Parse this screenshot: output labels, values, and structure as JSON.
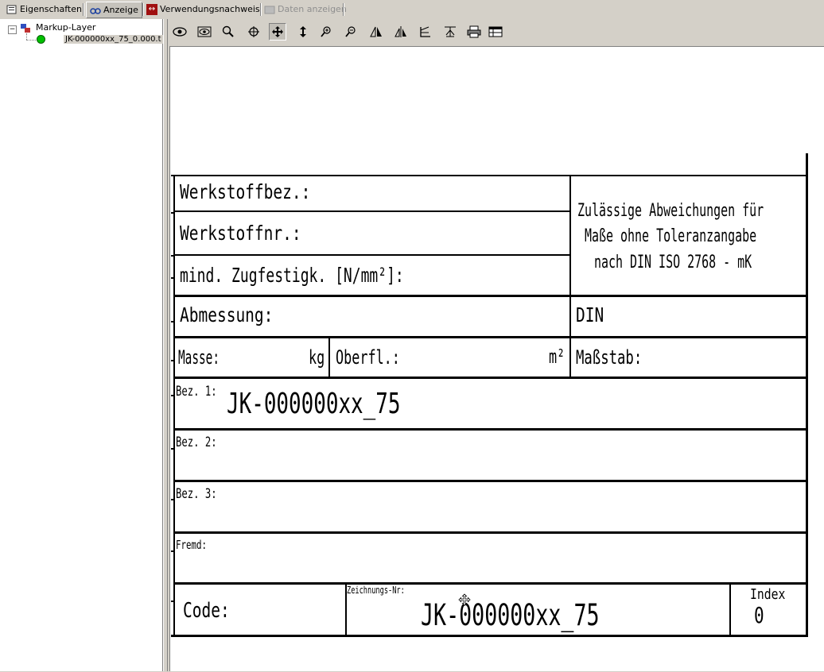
{
  "tabs": [
    {
      "label": "Eigenschaften",
      "icon": "properties-icon"
    },
    {
      "label": "Anzeige",
      "icon": "glasses-icon"
    },
    {
      "label": "Verwendungsnachweis",
      "icon": "where-used-icon"
    },
    {
      "label": "Daten anzeigen",
      "icon": "data-icon"
    }
  ],
  "tree": {
    "root_label": "Markup-Layer",
    "child_label": "JK-000000xx_75_0.000.t"
  },
  "toolbar": {
    "tools": [
      "eye-icon",
      "view-icon",
      "zoom-icon",
      "pan-center-icon",
      "move-icon",
      "vertical-arrow-icon",
      "zoom-in-icon",
      "zoom-out-icon",
      "mirror-horizontal-icon",
      "mirror-vertical-icon",
      "rotate-icon",
      "fit-icon",
      "print-icon",
      "table-icon"
    ]
  },
  "drawing": {
    "werkstoffbez": "Werkstoffbez.:",
    "werkstoffnr": "Werkstoffnr.:",
    "zugfestigkeit": "mind. Zugfestigk. [N/mm²]:",
    "abweichungen_1": "Zulässige Abweichungen für",
    "abweichungen_2": "Maße ohne Toleranzangabe",
    "abweichungen_3": "nach DIN ISO 2768 - mK",
    "abmessung": "Abmessung:",
    "din": "DIN",
    "masse": "Masse:",
    "masse_unit": "kg",
    "oberfl": "Oberfl.:",
    "oberfl_unit": "m²",
    "massstab": "Maßstab:",
    "bez1_label": "Bez. 1:",
    "bez1_value": "JK-000000xx_75",
    "bez2_label": "Bez. 2:",
    "bez3_label": "Bez. 3:",
    "fremd_label": "Fremd:",
    "code_label": "Code:",
    "zeichnungsnr_label": "Zeichnungs-Nr:",
    "zeichnungsnr_value": "JK-000000xx_75",
    "index_label": "Index",
    "index_value": "0"
  },
  "colors": {
    "selection_bg": "#0a246a",
    "tree_node": "#00c000",
    "window_bg": "#d4d0c8"
  }
}
